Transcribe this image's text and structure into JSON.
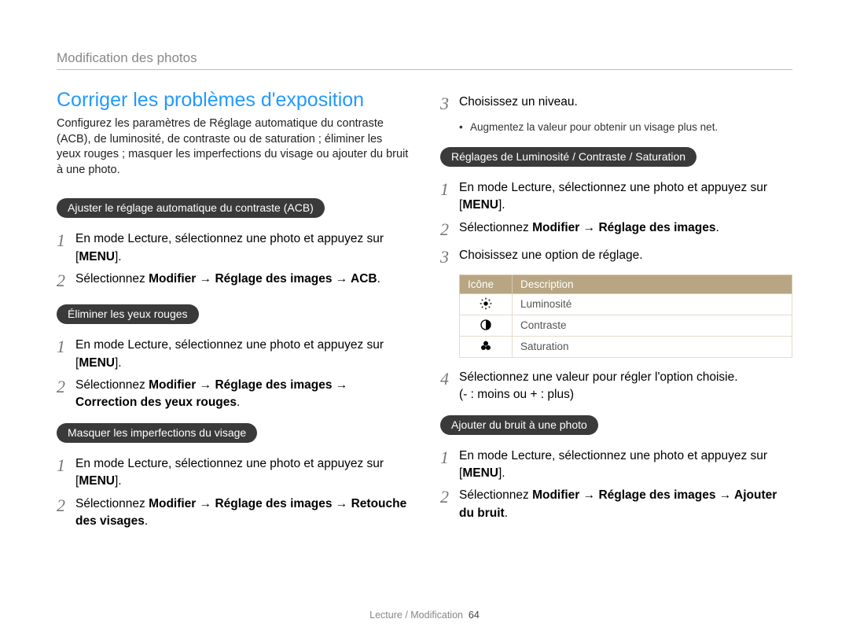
{
  "header": "Modification des photos",
  "left": {
    "title": "Corriger les problèmes d'exposition",
    "intro": "Configurez les paramètres de Réglage automatique du contraste (ACB), de luminosité, de contraste ou de saturation ; éliminer les yeux rouges ; masquer les imperfections du visage ou ajouter du bruit à une photo.",
    "pill_acb": "Ajuster le réglage automatique du contraste (ACB)",
    "acb_step1_a": "En mode Lecture, sélectionnez une photo et appuyez sur [",
    "menu": "MENU",
    "close_bracket_dot": "].",
    "acb_step2_a": "Sélectionnez ",
    "acb_step2_b": "Modifier → Réglage des images → ACB",
    "dot": ".",
    "pill_redeye": "Éliminer les yeux rouges",
    "redeye_step1_a": "En mode Lecture, sélectionnez une photo et appuyez sur [",
    "redeye_step2_a": "Sélectionnez ",
    "redeye_step2_b": "Modifier →  Réglage des images → Correction des yeux rouges",
    "pill_face": "Masquer les imperfections du visage",
    "face_step1_a": "En mode Lecture, sélectionnez une photo et appuyez sur [",
    "face_step2_a": "Sélectionnez ",
    "face_step2_b": "Modifier →  Réglage des images → Retouche des visages"
  },
  "right": {
    "lvl_step3": "Choisissez un niveau.",
    "lvl_bullet": "Augmentez la valeur pour obtenir un visage plus net.",
    "pill_bcs": "Réglages de Luminosité / Contraste / Saturation",
    "bcs_step1_a": "En mode Lecture, sélectionnez une photo et appuyez sur [",
    "bcs_step2_a": "Sélectionnez ",
    "bcs_step2_b": "Modifier → Réglage des images",
    "bcs_step3": "Choisissez une option de réglage.",
    "table": {
      "h_icon": "Icône",
      "h_desc": "Description",
      "r1": "Luminosité",
      "r2": "Contraste",
      "r3": "Saturation"
    },
    "bcs_step4_a": "Sélectionnez une valeur pour régler l'option choisie.",
    "bcs_step4_b": "(- : moins ou + : plus)",
    "pill_noise": "Ajouter du bruit à une photo",
    "noise_step1_a": "En mode Lecture, sélectionnez une photo et appuyez sur [",
    "noise_step2_a": "Sélectionnez ",
    "noise_step2_b": "Modifier → Réglage des images → Ajouter du bruit"
  },
  "nums": {
    "n1": "1",
    "n2": "2",
    "n3": "3",
    "n4": "4"
  },
  "footer": {
    "section": "Lecture / Modification",
    "page": "64"
  }
}
